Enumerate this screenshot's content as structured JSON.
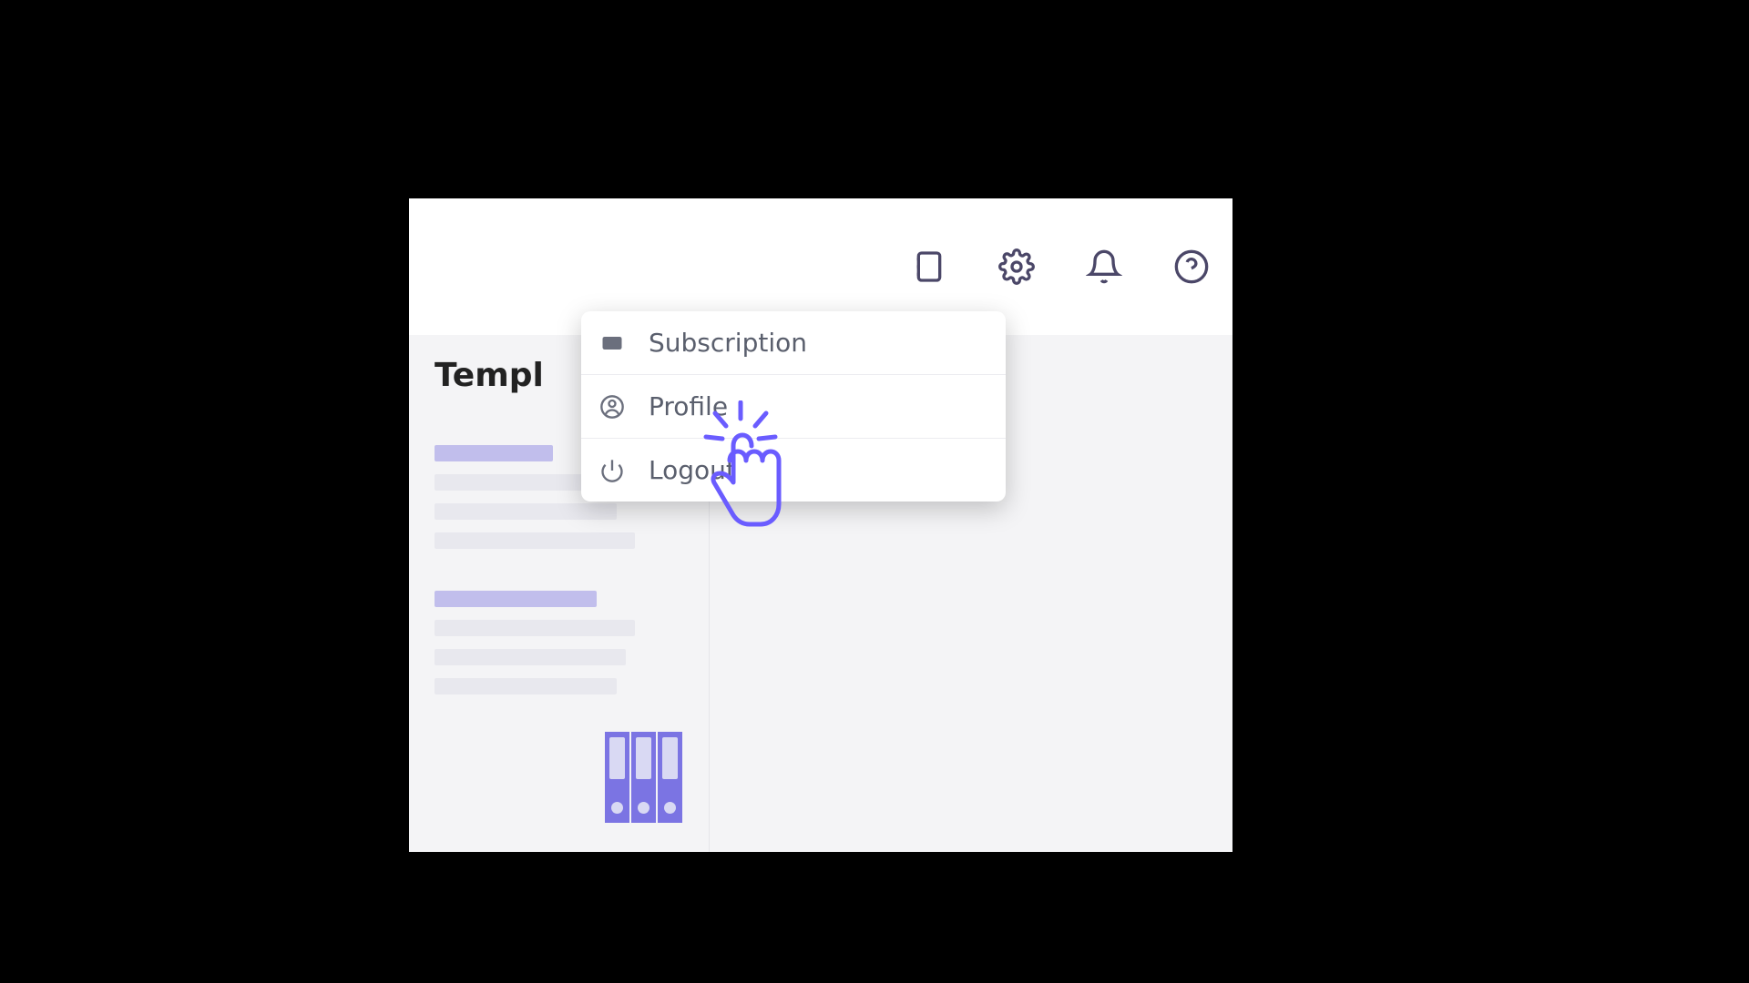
{
  "toolbar": {
    "icons": {
      "journal": "journal-icon",
      "settings": "gear-icon",
      "notifications": "bell-icon",
      "help": "help-icon"
    }
  },
  "sidebar": {
    "title": "Templ"
  },
  "dropdown": {
    "items": [
      {
        "icon": "wallet-icon",
        "label": "Subscription"
      },
      {
        "icon": "user-circle-icon",
        "label": "Profile"
      },
      {
        "icon": "power-icon",
        "label": "Logout"
      }
    ]
  },
  "cursor": {
    "target_label": "Profile",
    "color": "#6a5cff"
  }
}
